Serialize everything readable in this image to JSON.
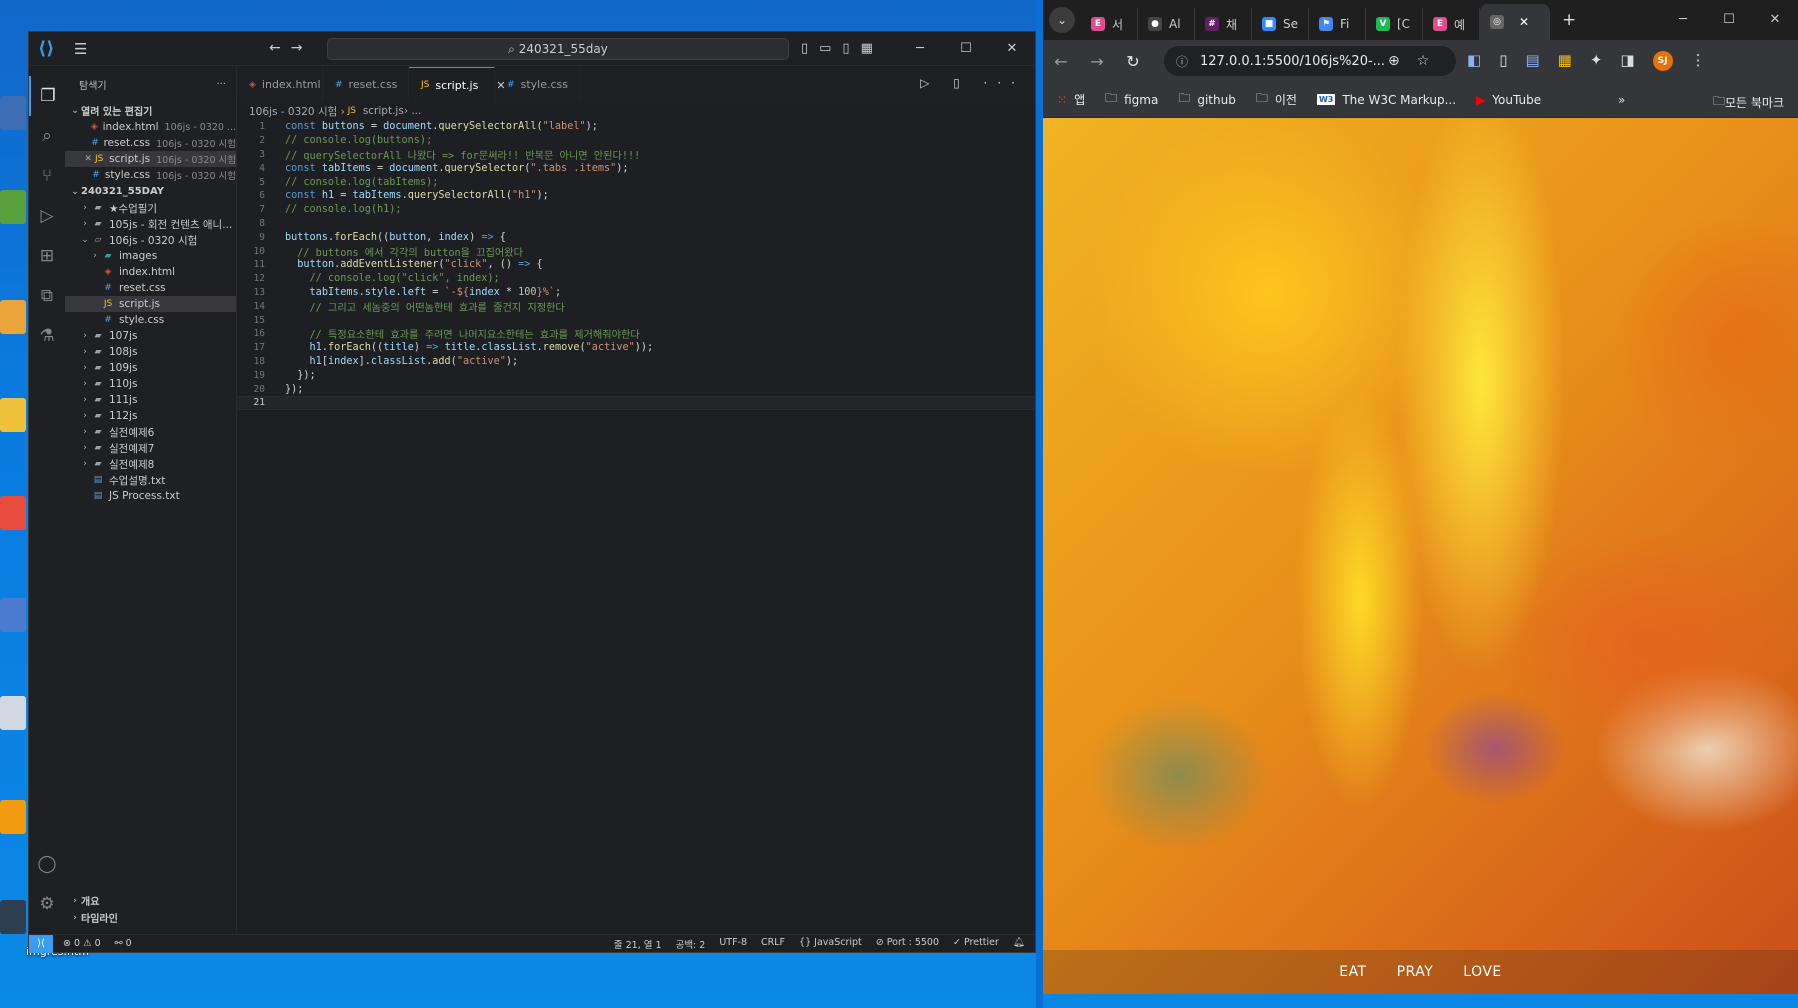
{
  "desktop": {
    "caption": "imgres.htm"
  },
  "vscode": {
    "search": "⌕ 240321_55day",
    "explorer_title": "탐색기",
    "open_editors_title": "열려 있는 편집기",
    "open_editors": [
      {
        "name": "index.html",
        "hint": "106js - 0320 ...",
        "icon": "html"
      },
      {
        "name": "reset.css",
        "hint": "106js - 0320 시험",
        "icon": "css"
      },
      {
        "name": "script.js",
        "hint": "106js - 0320 시험",
        "icon": "js"
      },
      {
        "name": "style.css",
        "hint": "106js - 0320 시험",
        "icon": "css"
      }
    ],
    "workspace_title": "240321_55DAY",
    "tree": [
      {
        "label": "★수업필기",
        "type": "folder"
      },
      {
        "label": "105js - 회전 컨텐츠 애니...",
        "type": "folder"
      },
      {
        "label": "106js - 0320 시험",
        "type": "folder-open"
      },
      {
        "label": "images",
        "type": "img-folder"
      },
      {
        "label": "index.html",
        "type": "html"
      },
      {
        "label": "reset.css",
        "type": "css"
      },
      {
        "label": "script.js",
        "type": "js"
      },
      {
        "label": "style.css",
        "type": "css"
      },
      {
        "label": "107js",
        "type": "folder"
      },
      {
        "label": "108js",
        "type": "folder"
      },
      {
        "label": "109js",
        "type": "folder"
      },
      {
        "label": "110js",
        "type": "folder"
      },
      {
        "label": "111js",
        "type": "folder"
      },
      {
        "label": "112js",
        "type": "folder"
      },
      {
        "label": "실전예제6",
        "type": "folder"
      },
      {
        "label": "실전예제7",
        "type": "folder"
      },
      {
        "label": "실전예제8",
        "type": "folder"
      },
      {
        "label": "수업설명.txt",
        "type": "txt"
      },
      {
        "label": "JS Process.txt",
        "type": "txt"
      }
    ],
    "outline_title": "개요",
    "timeline_title": "타임라인",
    "tabs": [
      {
        "label": "index.html",
        "icon": "html"
      },
      {
        "label": "reset.css",
        "icon": "css"
      },
      {
        "label": "script.js",
        "icon": "js"
      },
      {
        "label": "style.css",
        "icon": "css"
      }
    ],
    "breadcrumb": "106js - 0320 시험  ›  ",
    "breadcrumb_file": "script.js",
    "breadcrumb_tail": "  ›  ...",
    "status": {
      "errors": "⊗ 0 ⚠ 0",
      "ports": "⚯ 0",
      "position": "줄 21, 열 1",
      "spaces": "공백: 2",
      "encoding": "UTF-8",
      "eol": "CRLF",
      "language": "{} JavaScript",
      "port": "⊘ Port : 5500",
      "prettier": "✓ Prettier"
    }
  },
  "chrome": {
    "tabs": [
      {
        "label": "서",
        "fav": "E",
        "color": "#e04b8f"
      },
      {
        "label": "Al",
        "fav": "●",
        "color": "#444"
      },
      {
        "label": "채",
        "fav": "#",
        "color": "#611f69"
      },
      {
        "label": "Se",
        "fav": "■",
        "color": "#2d8cff"
      },
      {
        "label": "Fi",
        "fav": "⚑",
        "color": "#4285f4"
      },
      {
        "label": "[C",
        "fav": "V",
        "color": "#1db954"
      },
      {
        "label": "예",
        "fav": "E",
        "color": "#e04b8f"
      },
      {
        "label": "",
        "fav": "◎",
        "color": "#666"
      }
    ],
    "url": "127.0.0.1:5500/106js%20-...",
    "bookmarks": [
      {
        "label": "앱",
        "icon": "apps"
      },
      {
        "label": "figma",
        "icon": "folder"
      },
      {
        "label": "github",
        "icon": "folder"
      },
      {
        "label": "이전",
        "icon": "folder"
      },
      {
        "label": "The W3C Markup...",
        "icon": "w3c"
      },
      {
        "label": "YouTube",
        "icon": "youtube"
      }
    ],
    "all_bookmarks": "모든 북마크",
    "avatar": "SJ",
    "page_menu": [
      "EAT",
      "PRAY",
      "LOVE"
    ]
  }
}
